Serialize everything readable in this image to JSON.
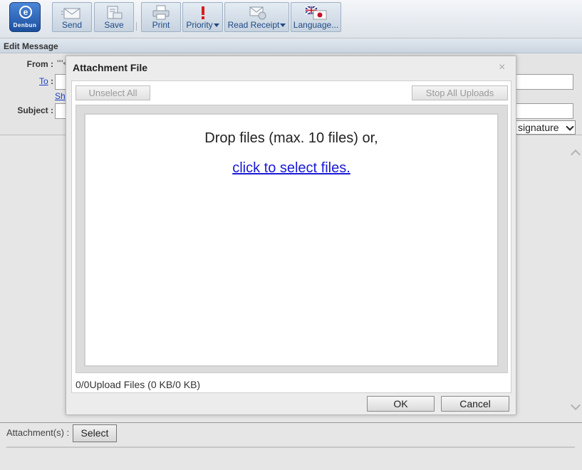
{
  "toolbar": {
    "logo_text": "Denbun",
    "send": "Send",
    "save": "Save",
    "print": "Print",
    "priority": "Priority",
    "read_receipt": "Read Receipt",
    "language": "Language..."
  },
  "edit_title": "Edit Message",
  "header": {
    "from_label": "From :",
    "from_value": "\"\"<",
    "to_label": "To",
    "to_colon": ":",
    "show_link": "Sh",
    "subject_label": "Subject :",
    "signature_select": "signature"
  },
  "attachments": {
    "label": "Attachment(s) :",
    "select_button": "Select"
  },
  "dialog": {
    "title": "Attachment File",
    "close_glyph": "×",
    "unselect_all": "Unselect All",
    "stop_all_uploads": "Stop All Uploads",
    "drop_text": "Drop files (max. 10 files) or,",
    "select_link": "click to select files.",
    "upload_status": "0/0Upload Files (0 KB/0 KB)",
    "ok": "OK",
    "cancel": "Cancel"
  }
}
